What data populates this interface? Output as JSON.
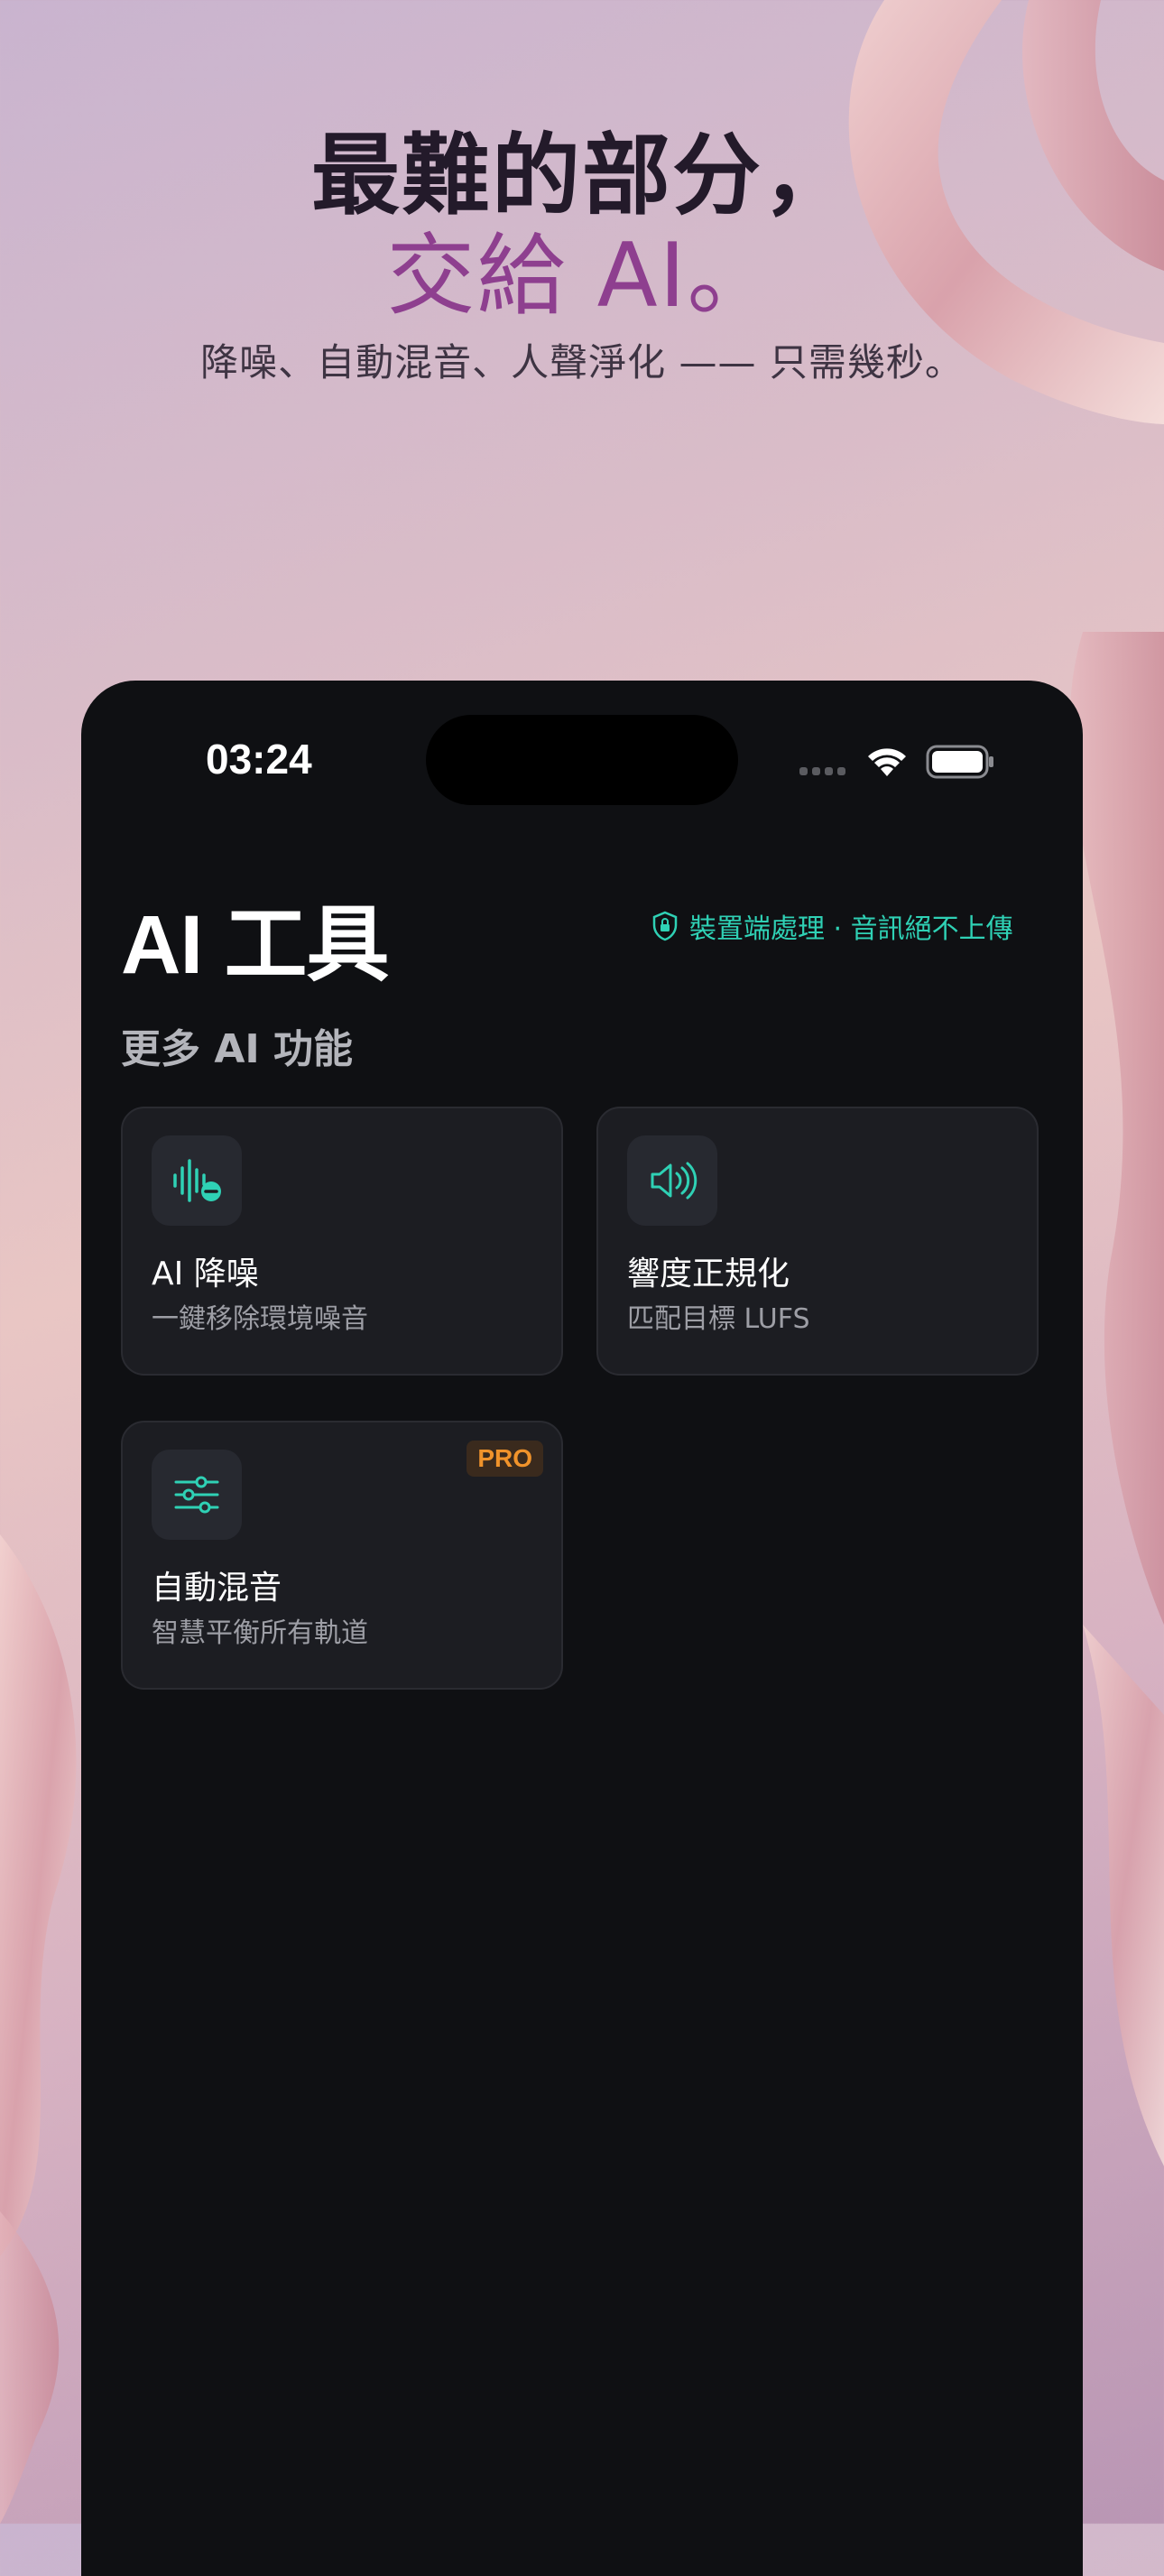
{
  "hero": {
    "line1": "最難的部分，",
    "line2": "交給 AI。",
    "subtitle": "降噪、自動混音、人聲淨化 —— 只需幾秒。"
  },
  "status_bar": {
    "time": "03:24"
  },
  "page": {
    "title": "AI 工具",
    "privacy_note": "裝置端處理 · 音訊絕不上傳",
    "section_title": "更多 AI 功能"
  },
  "tools": [
    {
      "icon": "waveform-minus-icon",
      "title": "AI 降噪",
      "subtitle": "一鍵移除環境噪音"
    },
    {
      "icon": "speaker-wave-icon",
      "title": "響度正規化",
      "subtitle": "匹配目標 LUFS"
    },
    {
      "icon": "sliders-icon",
      "title": "自動混音",
      "subtitle": "智慧平衡所有軌道",
      "badge": "PRO"
    }
  ],
  "colors": {
    "accent": "#2fd1b5",
    "headline_purple": "#8e3f8f",
    "pro_badge": "#f0932b"
  }
}
